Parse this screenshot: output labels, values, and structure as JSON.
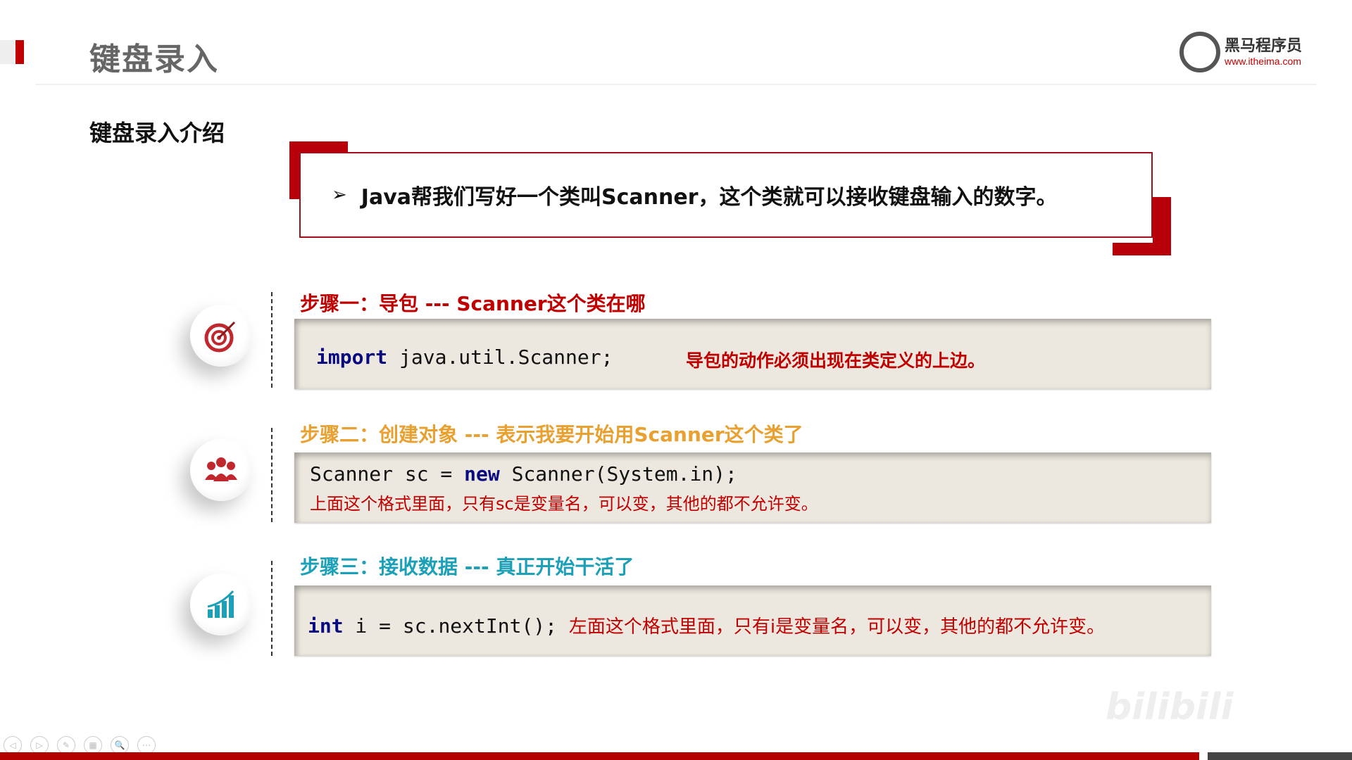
{
  "header": {
    "title": "键盘录入",
    "logo_brand": "黑马程序员",
    "logo_url": "www.itheima.com"
  },
  "subtitle": "键盘录入介绍",
  "callout": {
    "bullet": "➢",
    "text": "Java帮我们写好一个类叫Scanner，这个类就可以接收键盘输入的数字。"
  },
  "steps": [
    {
      "heading": "步骤一：导包  ---  Scanner这个类在哪",
      "color": "#c00000",
      "icon": "target-icon",
      "code_kw": "import",
      "code_rest": " java.util.Scanner;",
      "note": "导包的动作必须出现在类定义的上边。"
    },
    {
      "heading": "步骤二：创建对象 --- 表示我要开始用Scanner这个类了",
      "color": "#e8a030",
      "icon": "team-icon",
      "code_pre": "Scanner sc = ",
      "code_kw": "new",
      "code_rest": " Scanner(System.in);",
      "note": "上面这个格式里面，只有sc是变量名，可以变，其他的都不允许变。"
    },
    {
      "heading": "步骤三：接收数据 --- 真正开始干活了",
      "color": "#1ca0b8",
      "icon": "growth-chart-icon",
      "code_kw": "int",
      "code_rest": " i = sc.nextInt(); ",
      "note": "左面这个格式里面，只有i是变量名，可以变，其他的都不允许变。"
    }
  ],
  "watermark": "bilibili",
  "nav": [
    "◁",
    "▷",
    "✎",
    "▦",
    "🔍",
    "⋯"
  ]
}
